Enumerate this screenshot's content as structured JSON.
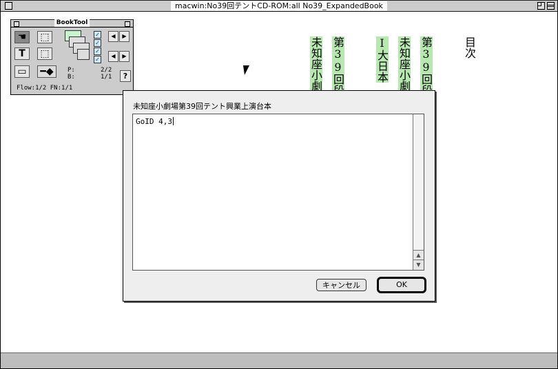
{
  "window": {
    "title": "macwin:No39回テントCD-ROM:all No39_ExpandedBook"
  },
  "document": {
    "columns": [
      "未知座小劇",
      "第39回段組",
      "Ⅰ大日本",
      "未知座小劇",
      "第39回段組",
      "目次"
    ]
  },
  "palette": {
    "title": "BookTool",
    "text_tool": "T",
    "p_label": "P:",
    "p_value": "2/2",
    "b_label": "B:",
    "b_value": "1/1",
    "flow": "Flow:1/2 FN:1/1",
    "help": "?"
  },
  "dialog": {
    "label": "未知座小劇場第39回テント興業上演台本",
    "text_value": "GoID 4,3",
    "cancel_label": "キャンセル",
    "ok_label": "OK"
  },
  "icons": [
    "close-icon",
    "zoom-icon",
    "collapse-icon",
    "hand-icon",
    "marquee-icon",
    "arrow-left-icon",
    "arrow-right-icon",
    "check-icon",
    "pointer-cursor-icon"
  ],
  "colors": {
    "highlight": "#b7e8b0",
    "dialog_bg": "#eeeeee",
    "bottom_bar": "#bdbdbd"
  }
}
